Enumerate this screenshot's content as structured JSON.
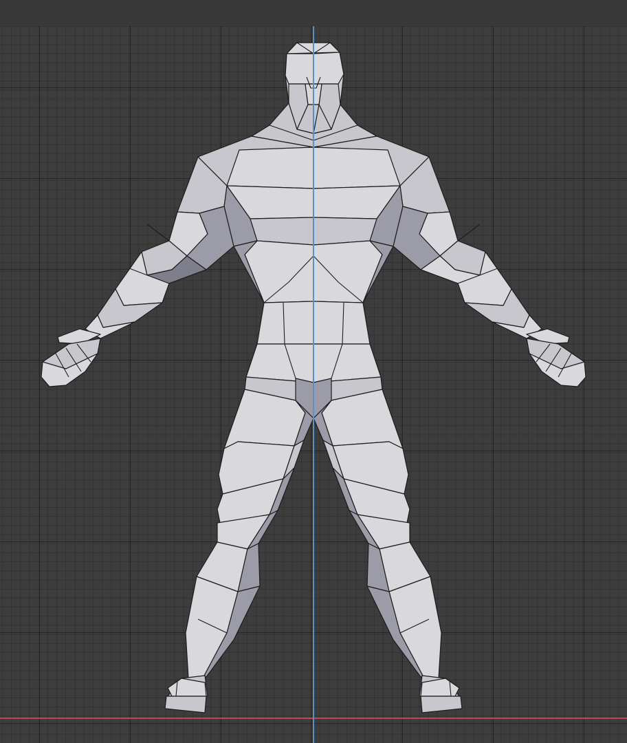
{
  "viewport": {
    "background": "#3d3d3d",
    "grid_color": "#2b2b2b",
    "z_axis_color": "#5e8fc4",
    "x_axis_color": "#b84a55"
  },
  "model": {
    "shading": "solid",
    "color": "#d9d9dd",
    "wire_color": "#1c1c1c"
  }
}
